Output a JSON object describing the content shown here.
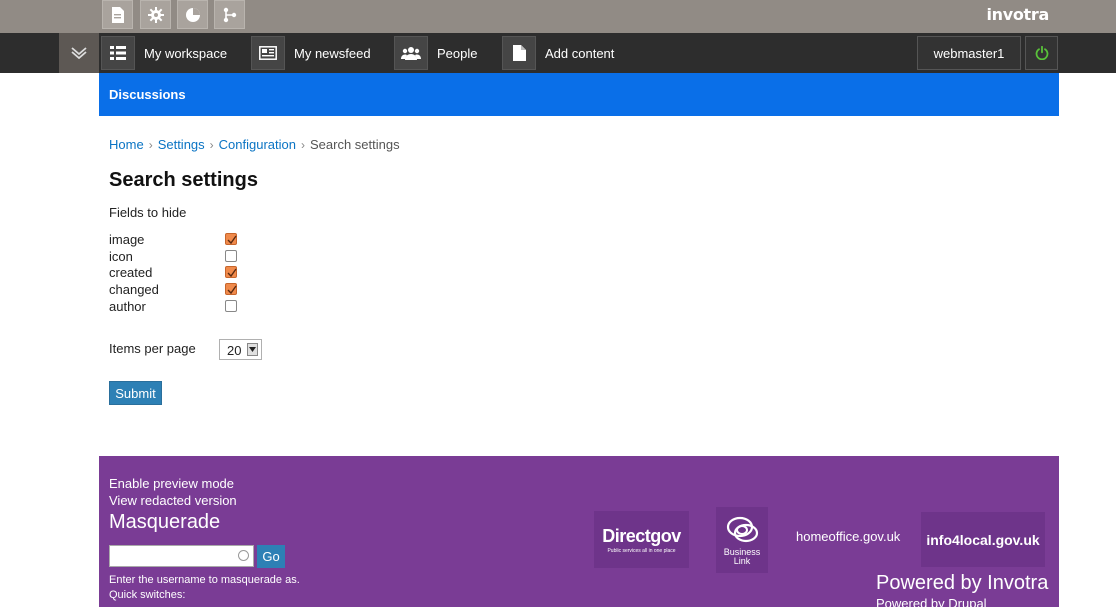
{
  "brand": "invotra",
  "nav": {
    "items": [
      {
        "label": "My workspace"
      },
      {
        "label": "My newsfeed"
      },
      {
        "label": "People"
      },
      {
        "label": "Add content"
      }
    ],
    "user": "webmaster1"
  },
  "header": {
    "title": "Discussions"
  },
  "breadcrumb": [
    "Home",
    "Settings",
    "Configuration",
    "Search settings"
  ],
  "page": {
    "title": "Search settings",
    "fields_label": "Fields to hide",
    "fields": [
      {
        "label": "image",
        "checked": true
      },
      {
        "label": "icon",
        "checked": false
      },
      {
        "label": "created",
        "checked": true
      },
      {
        "label": "changed",
        "checked": true
      },
      {
        "label": "author",
        "checked": false
      }
    ],
    "items_per_page_label": "Items per page",
    "items_per_page_value": "20",
    "submit_label": "Submit"
  },
  "footer": {
    "preview_mode": "Enable preview mode",
    "redacted": "View redacted version",
    "masquerade_title": "Masquerade",
    "go_label": "Go",
    "masquerade_hint": "Enter the username to masquerade as.",
    "quick_switches": "Quick switches:",
    "logos": {
      "directgov": "Directgov",
      "directgov_tagline": "Public services all in one place",
      "businesslink_1": "Business",
      "businesslink_2": "Link",
      "homeoffice": "homeoffice.gov.uk",
      "info4local": "info4local.gov.uk"
    },
    "powered_invotra": "Powered by Invotra",
    "powered_drupal": "Powered by Drupal"
  },
  "colors": {
    "topbar": "#918b85",
    "navbar": "#2d2d2d",
    "header_blue": "#0a6fe8",
    "footer_purple": "#7a3c95",
    "accent_button": "#2d80b5",
    "checkbox_checked": "#f08a4b",
    "power_icon": "#59c23a"
  }
}
